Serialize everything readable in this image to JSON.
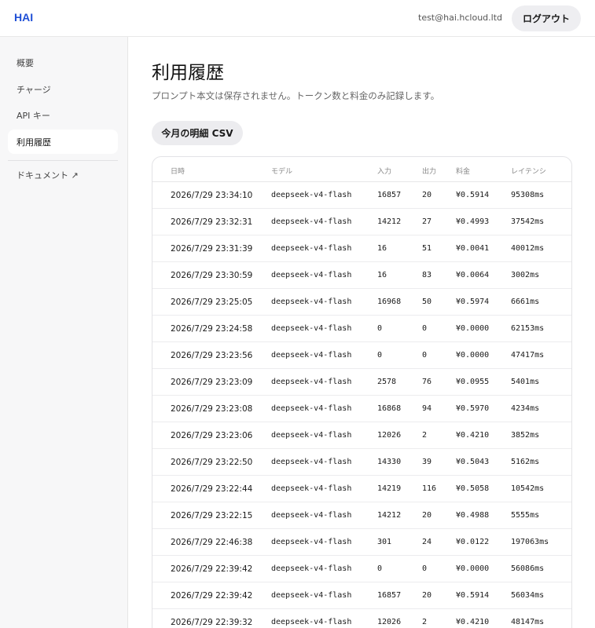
{
  "header": {
    "logo": "HAI",
    "user_email": "test@hai.hcloud.ltd",
    "logout_label": "ログアウト"
  },
  "sidebar": {
    "items": [
      {
        "label": "概要"
      },
      {
        "label": "チャージ"
      },
      {
        "label": "API キー"
      },
      {
        "label": "利用履歴"
      }
    ],
    "docs_label": "ドキュメント ↗"
  },
  "main": {
    "title": "利用履歴",
    "subtitle": "プロンプト本文は保存されません。トークン数と料金のみ記録します。",
    "csv_label": "今月の明細 CSV"
  },
  "table": {
    "headers": [
      "日時",
      "モデル",
      "入力",
      "出力",
      "料金",
      "レイテンシ"
    ],
    "rows": [
      [
        "2026/7/29 23:34:10",
        "deepseek-v4-flash",
        "16857",
        "20",
        "¥0.5914",
        "95308ms"
      ],
      [
        "2026/7/29 23:32:31",
        "deepseek-v4-flash",
        "14212",
        "27",
        "¥0.4993",
        "37542ms"
      ],
      [
        "2026/7/29 23:31:39",
        "deepseek-v4-flash",
        "16",
        "51",
        "¥0.0041",
        "40012ms"
      ],
      [
        "2026/7/29 23:30:59",
        "deepseek-v4-flash",
        "16",
        "83",
        "¥0.0064",
        "3002ms"
      ],
      [
        "2026/7/29 23:25:05",
        "deepseek-v4-flash",
        "16968",
        "50",
        "¥0.5974",
        "6661ms"
      ],
      [
        "2026/7/29 23:24:58",
        "deepseek-v4-flash",
        "0",
        "0",
        "¥0.0000",
        "62153ms"
      ],
      [
        "2026/7/29 23:23:56",
        "deepseek-v4-flash",
        "0",
        "0",
        "¥0.0000",
        "47417ms"
      ],
      [
        "2026/7/29 23:23:09",
        "deepseek-v4-flash",
        "2578",
        "76",
        "¥0.0955",
        "5401ms"
      ],
      [
        "2026/7/29 23:23:08",
        "deepseek-v4-flash",
        "16868",
        "94",
        "¥0.5970",
        "4234ms"
      ],
      [
        "2026/7/29 23:23:06",
        "deepseek-v4-flash",
        "12026",
        "2",
        "¥0.4210",
        "3852ms"
      ],
      [
        "2026/7/29 23:22:50",
        "deepseek-v4-flash",
        "14330",
        "39",
        "¥0.5043",
        "5162ms"
      ],
      [
        "2026/7/29 23:22:44",
        "deepseek-v4-flash",
        "14219",
        "116",
        "¥0.5058",
        "10542ms"
      ],
      [
        "2026/7/29 23:22:15",
        "deepseek-v4-flash",
        "14212",
        "20",
        "¥0.4988",
        "5555ms"
      ],
      [
        "2026/7/29 22:46:38",
        "deepseek-v4-flash",
        "301",
        "24",
        "¥0.0122",
        "197063ms"
      ],
      [
        "2026/7/29 22:39:42",
        "deepseek-v4-flash",
        "0",
        "0",
        "¥0.0000",
        "56086ms"
      ],
      [
        "2026/7/29 22:39:42",
        "deepseek-v4-flash",
        "16857",
        "20",
        "¥0.5914",
        "56034ms"
      ],
      [
        "2026/7/29 22:39:32",
        "deepseek-v4-flash",
        "12026",
        "2",
        "¥0.4210",
        "48147ms"
      ]
    ]
  },
  "colors": {
    "brand": "#1f4fd6",
    "sidebar_bg": "#f7f7f8",
    "button_bg": "#ececef"
  }
}
